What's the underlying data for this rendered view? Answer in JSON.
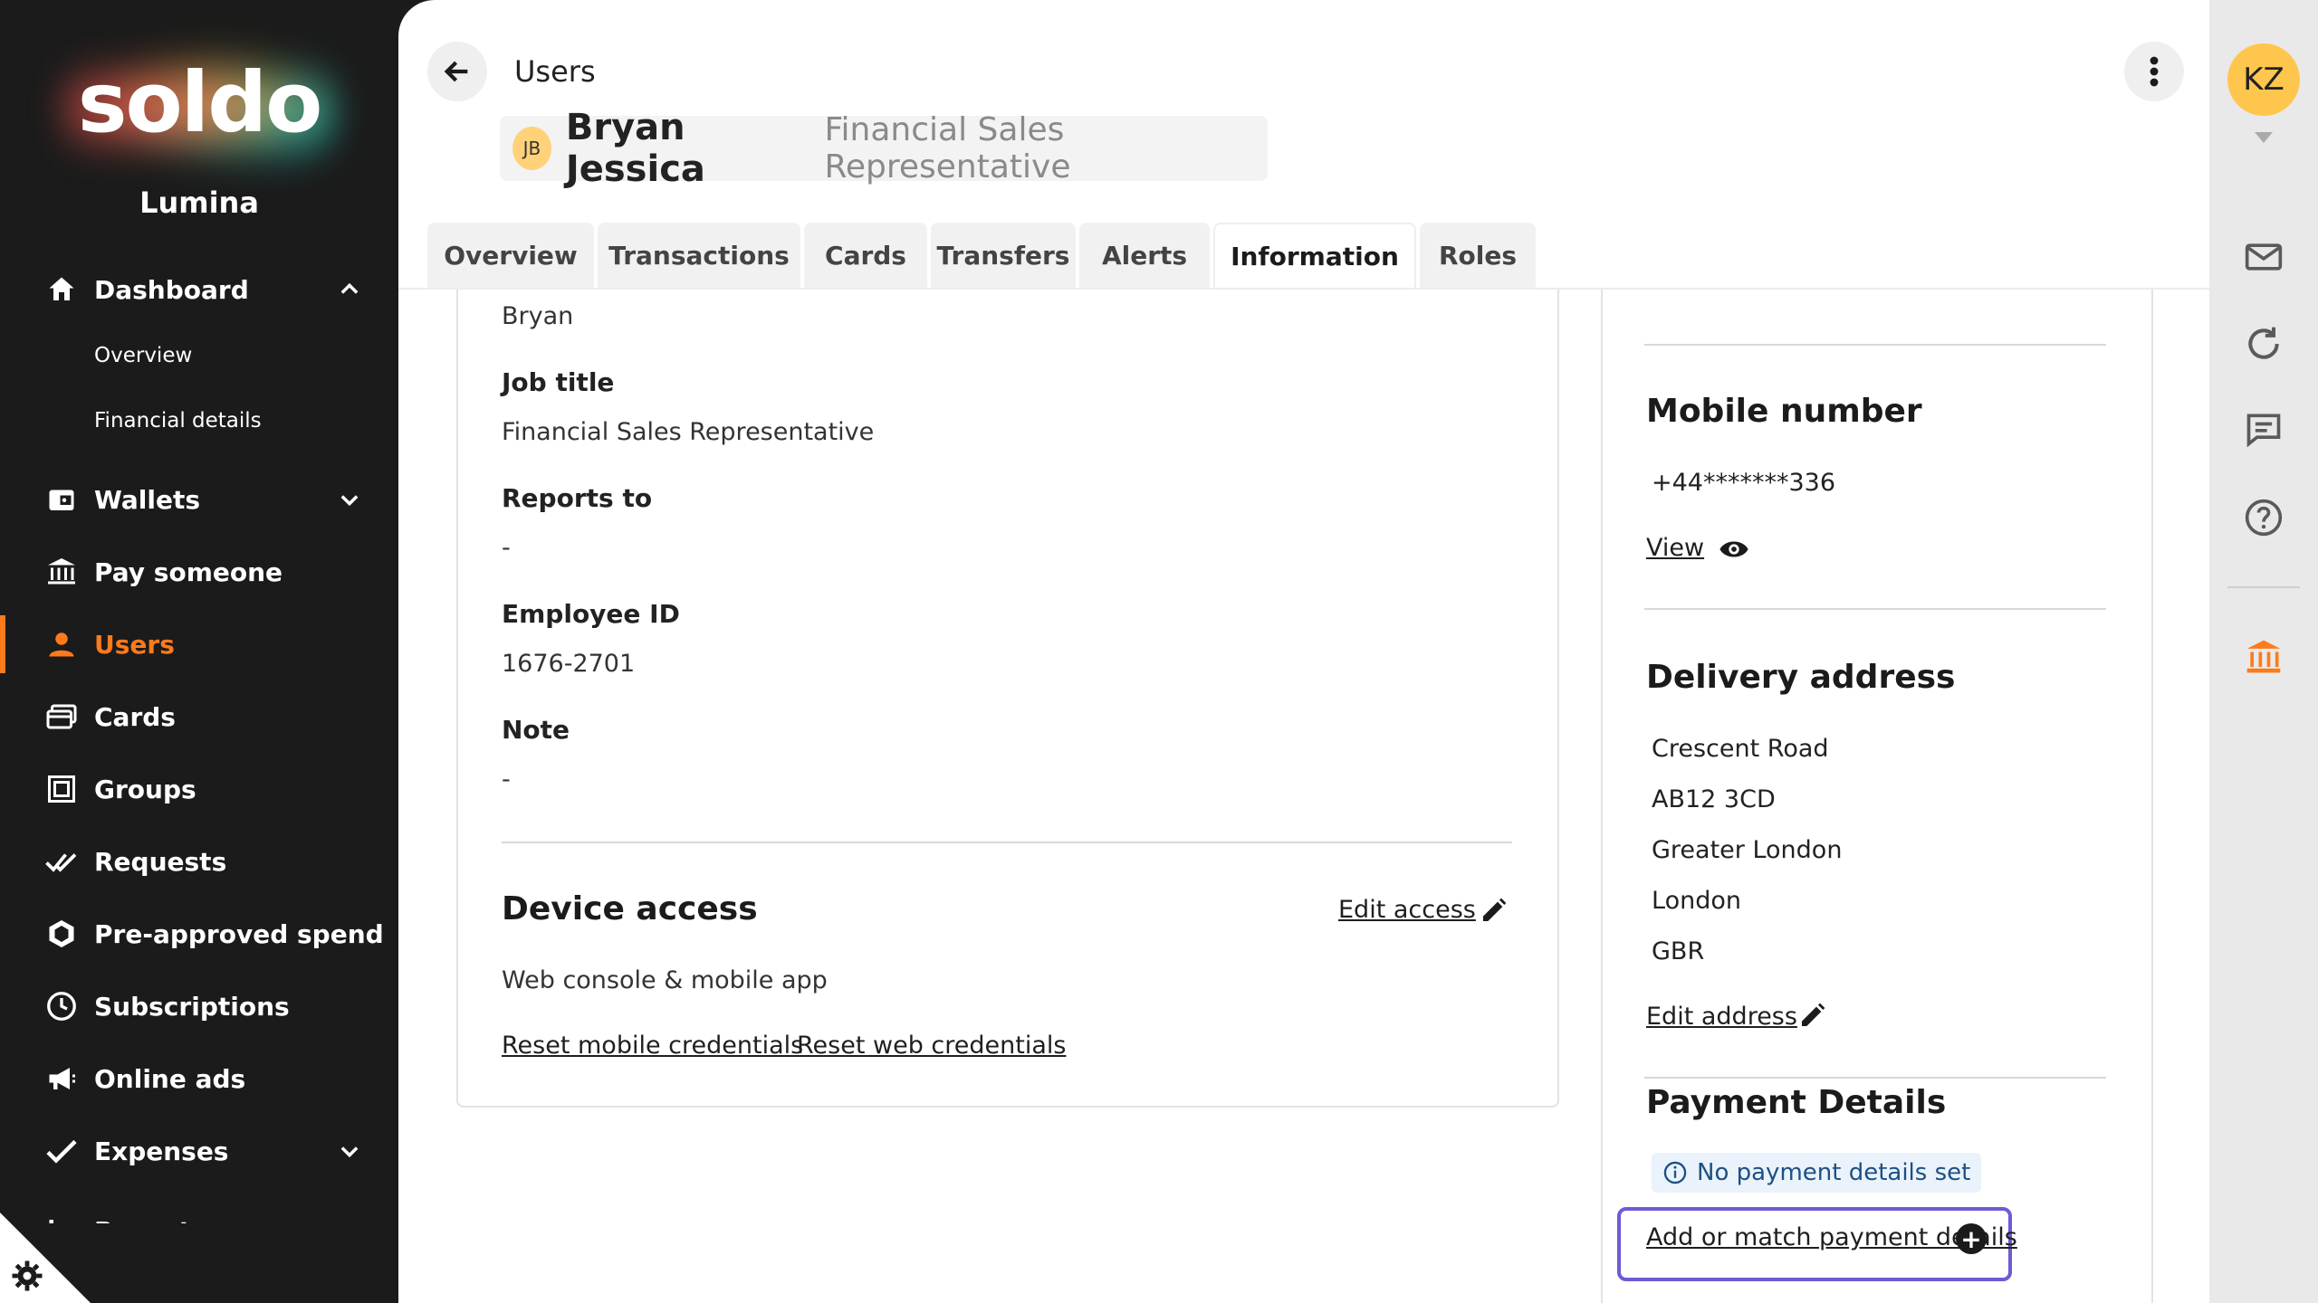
{
  "sidebar": {
    "logo_text": "soldo",
    "company": "Lumina",
    "items": [
      {
        "label": "Dashboard"
      },
      {
        "label": "Wallets"
      },
      {
        "label": "Pay someone"
      },
      {
        "label": "Users"
      },
      {
        "label": "Cards"
      },
      {
        "label": "Groups"
      },
      {
        "label": "Requests"
      },
      {
        "label": "Pre-approved spend"
      },
      {
        "label": "Subscriptions"
      },
      {
        "label": "Online ads"
      },
      {
        "label": "Expenses"
      },
      {
        "label": "Reports"
      }
    ],
    "dashboard_sub": [
      "Overview",
      "Financial details"
    ],
    "active_color": "#ff7a1a"
  },
  "header": {
    "breadcrumb": "Users",
    "avatar_initials": "JB",
    "name": "Bryan Jessica",
    "role": "Financial Sales Representative"
  },
  "tabs": [
    "Overview",
    "Transactions",
    "Cards",
    "Transfers",
    "Alerts",
    "Information",
    "Roles"
  ],
  "active_tab": "Information",
  "info": {
    "first_name_value": "Bryan",
    "job_title_label": "Job title",
    "job_title_value": "Financial Sales Representative",
    "reports_to_label": "Reports to",
    "reports_to_value": "-",
    "employee_id_label": "Employee ID",
    "employee_id_value": "1676-2701",
    "note_label": "Note",
    "note_value": "-"
  },
  "device_access": {
    "title": "Device access",
    "edit_label": "Edit access",
    "value": "Web console & mobile app",
    "reset_mobile": "Reset mobile credentials",
    "reset_web": "Reset web credentials"
  },
  "mobile": {
    "title": "Mobile number",
    "value": "+44*******336",
    "view_label": "View"
  },
  "delivery": {
    "title": "Delivery address",
    "lines": [
      "Crescent Road",
      "AB12 3CD",
      "Greater London",
      "London",
      "GBR"
    ],
    "edit_label": "Edit address"
  },
  "payment": {
    "title": "Payment Details",
    "badge": "No payment details set",
    "add_label": "Add or match payment details"
  },
  "rail": {
    "avatar_initials": "KZ"
  }
}
